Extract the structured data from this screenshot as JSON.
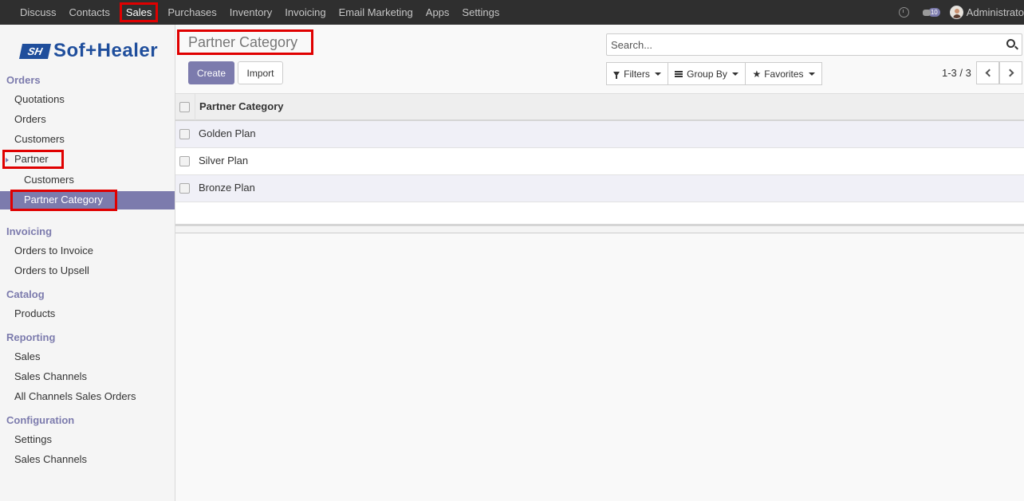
{
  "topbar": {
    "menu": [
      "Discuss",
      "Contacts",
      "Sales",
      "Purchases",
      "Inventory",
      "Invoicing",
      "Email Marketing",
      "Apps",
      "Settings"
    ],
    "active": "Sales",
    "messages_count": "10",
    "user": "Administrato"
  },
  "logo": {
    "mark": "SH",
    "text": "Sof+Healer"
  },
  "sidebar": {
    "orders_title": "Orders",
    "quotations": "Quotations",
    "orders": "Orders",
    "customers": "Customers",
    "partner": "Partner",
    "partner_customers": "Customers",
    "partner_category": "Partner Category",
    "invoicing_title": "Invoicing",
    "orders_to_invoice": "Orders to Invoice",
    "orders_to_upsell": "Orders to Upsell",
    "catalog_title": "Catalog",
    "products": "Products",
    "reporting_title": "Reporting",
    "sales": "Sales",
    "sales_channels": "Sales Channels",
    "all_channels": "All Channels Sales Orders",
    "configuration_title": "Configuration",
    "settings": "Settings",
    "config_sales_channels": "Sales Channels"
  },
  "control": {
    "breadcrumb": "Partner Category",
    "create": "Create",
    "import": "Import",
    "search_placeholder": "Search...",
    "filters": "Filters",
    "group_by": "Group By",
    "favorites": "Favorites",
    "pager": "1-3 / 3"
  },
  "list": {
    "header": "Partner Category",
    "rows": [
      "Golden Plan",
      "Silver Plan",
      "Bronze Plan"
    ]
  },
  "colors": {
    "accent": "#7c7bad",
    "highlight": "#e00000",
    "navbar": "#2f2f2f"
  }
}
